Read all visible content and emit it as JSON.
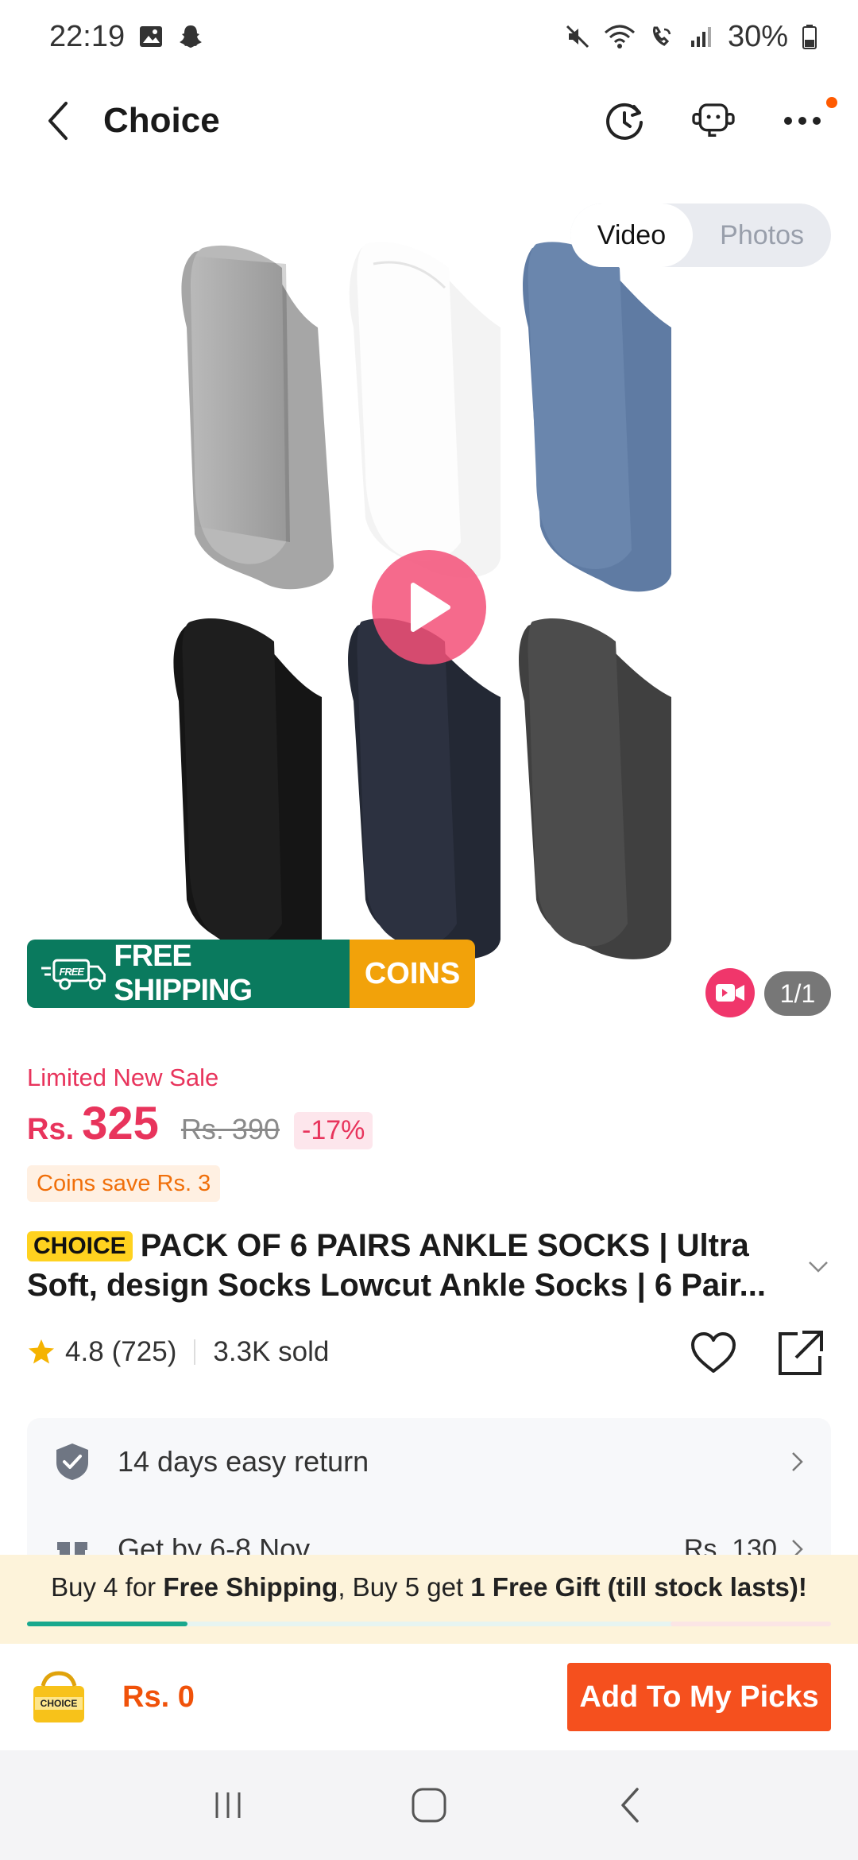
{
  "status_bar": {
    "time": "22:19",
    "battery": "30%"
  },
  "header": {
    "title": "Choice"
  },
  "gallery": {
    "media_tabs": [
      "Video",
      "Photos"
    ],
    "active_tab": "Video",
    "counter": "1/1",
    "promo_free_badge": "FREE",
    "promo_free_label": "FREE SHIPPING",
    "promo_coins_label": "COINS"
  },
  "product": {
    "sale_label": "Limited New Sale",
    "currency": "Rs.",
    "price": "325",
    "original_price": "Rs. 390",
    "discount": "-17%",
    "coins_save": "Coins save Rs. 3",
    "choice_tag": "CHOICE",
    "title": "PACK OF 6 PAIRS ANKLE SOCKS | Ultra Soft, design Socks Lowcut Ankle Socks | 6 Pair...",
    "rating": "4.8",
    "reviews": "(725)",
    "sold": "3.3K sold"
  },
  "services": [
    {
      "label": "14 days easy return",
      "value": ""
    },
    {
      "label": "Get by 6-8 Nov",
      "value": "Rs. 130"
    }
  ],
  "shipping_promo": {
    "prefix": "Buy 4 for ",
    "bold1": "Free Shipping",
    "middle": ", Buy 5 get ",
    "bold2": "1 Free Gift (till stock lasts)!",
    "progress": 0.2
  },
  "bottom_bar": {
    "cart_badge": "CHOICE",
    "total": "Rs. 0",
    "add_button": "Add To My Picks"
  },
  "colors": {
    "accent": "#f5501e",
    "price": "#e8345c",
    "shipping_green": "#0a7a5e",
    "coins_orange": "#f2a20a",
    "choice_yellow": "#ffd21f"
  }
}
